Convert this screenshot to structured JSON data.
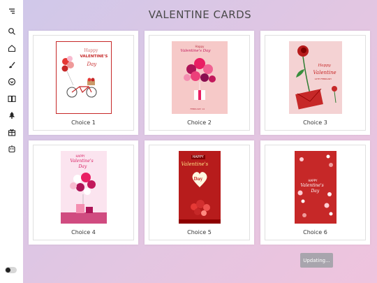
{
  "page": {
    "title": "VALENTINE CARDS"
  },
  "sidebar": {
    "icons": [
      "menu-icon",
      "search-icon",
      "home-icon",
      "paint-icon",
      "badge-icon",
      "book-icon",
      "tree-icon",
      "gift-icon",
      "robot-icon"
    ]
  },
  "cards": [
    {
      "label": "Choice 1",
      "thumb": {
        "title_lines": [
          "Happy",
          "VALENTINE'S",
          "Day"
        ]
      }
    },
    {
      "label": "Choice 2",
      "thumb": {
        "title_lines": [
          "Happy",
          "Valentine's Day"
        ],
        "footer": "FEBRUARY 14"
      }
    },
    {
      "label": "Choice 3",
      "thumb": {
        "title_lines": [
          "Happy",
          "Valentine"
        ],
        "subtitle": "14TH FEBRUARY"
      }
    },
    {
      "label": "Choice 4",
      "thumb": {
        "title_lines": [
          "HAPPY",
          "Valentine's",
          "Day"
        ]
      }
    },
    {
      "label": "Choice 5",
      "thumb": {
        "title_lines": [
          "HAPPY",
          "Valentine's",
          "Day"
        ]
      }
    },
    {
      "label": "Choice 6",
      "thumb": {
        "title_lines": [
          "HAPPY",
          "Valentine's",
          "Day"
        ]
      }
    }
  ],
  "status": {
    "updating_label": "Updating..."
  },
  "colors": {
    "accent": "#c62828",
    "bg_gradient_start": "#cfc8ea",
    "bg_gradient_end": "#efc3dd"
  }
}
